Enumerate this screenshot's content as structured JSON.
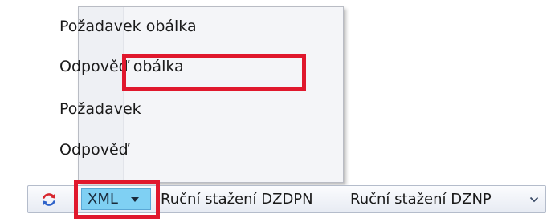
{
  "menu": {
    "items": [
      {
        "label": "Požadavek obálka"
      },
      {
        "label": "Odpověď obálka",
        "highlighted": true
      },
      {
        "label": "Požadavek"
      },
      {
        "label": "Odpověď"
      }
    ]
  },
  "toolbar": {
    "refresh_icon": "refresh-icon",
    "xml_label": "XML",
    "xml_highlighted": true,
    "manual_dzdpn_label": "Ruční stažení DZDPN",
    "manual_dznp_label": "Ruční stažení DZNP",
    "overflow_icon": "chevron-down-icon"
  },
  "colors": {
    "highlight": "#e0182d",
    "xml_button_bg": "#7fd0f3",
    "refresh_red": "#d7262e",
    "refresh_blue": "#2e62c9"
  }
}
